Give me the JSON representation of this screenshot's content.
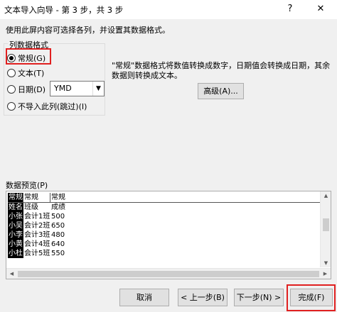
{
  "window": {
    "title": "文本导入向导 - 第 3 步，共 3 步",
    "help_label": "?",
    "close_label": "✕"
  },
  "instruction": "使用此屏内容可选择各列，并设置其数据格式。",
  "format_group": {
    "legend": "列数据格式",
    "options": [
      {
        "label": "常规(G)",
        "checked": true
      },
      {
        "label": "文本(T)",
        "checked": false
      },
      {
        "label": "日期(D)",
        "checked": false
      },
      {
        "label": "不导入此列(跳过)(I)",
        "checked": false
      }
    ],
    "date_format": "YMD"
  },
  "description": "\"常规\"数据格式将数值转换成数字，日期值会转换成日期，其余数据则转换成文本。",
  "advanced_button": "高级(A)...",
  "preview": {
    "label": "数据预览(P)",
    "headers": [
      "常规",
      "常规",
      "常规"
    ],
    "rows": [
      [
        "姓名",
        "班级",
        "成绩"
      ],
      [
        "小张",
        "会计1班",
        "500"
      ],
      [
        "小吴",
        "会计2班",
        "650"
      ],
      [
        "小李",
        "会计3班",
        "480"
      ],
      [
        "小黄",
        "会计4班",
        "640"
      ],
      [
        "小杜",
        "会计5班",
        "550"
      ]
    ]
  },
  "buttons": {
    "cancel": "取消",
    "back": "< 上一步(B)",
    "next": "下一步(N) >",
    "finish": "完成(F)"
  },
  "colors": {
    "highlight": "#e02020",
    "selected_column": "#000000"
  }
}
